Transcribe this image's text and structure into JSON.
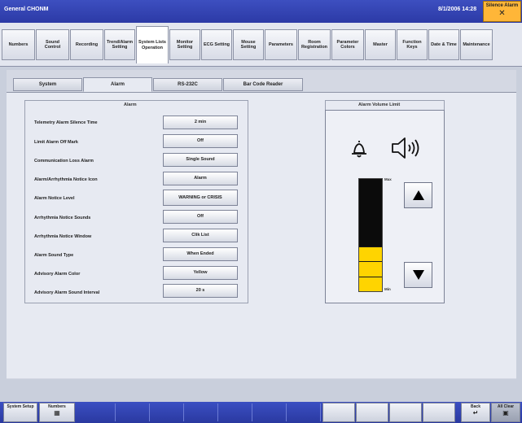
{
  "titlebar": {
    "app_title": "General CHONM",
    "datetime": "8/1/2006 14:28",
    "silence_label": "Silence Alarm"
  },
  "top_tabs": [
    {
      "label": "Numbers"
    },
    {
      "label": "Sound Control"
    },
    {
      "label": "Recording"
    },
    {
      "label": "Trend/Alarm Setting"
    },
    {
      "label": "System Lists Operation"
    },
    {
      "label": "Monitor Setting"
    },
    {
      "label": "ECG Setting"
    },
    {
      "label": "Mouse Setting"
    },
    {
      "label": "Parameters"
    },
    {
      "label": "Room Registration"
    },
    {
      "label": "Parameter Colors"
    },
    {
      "label": "Master"
    },
    {
      "label": "Function Keys"
    },
    {
      "label": "Date & Time"
    },
    {
      "label": "Maintenance"
    }
  ],
  "sub_tabs": [
    {
      "label": "System"
    },
    {
      "label": "Alarm"
    },
    {
      "label": "RS-232C"
    },
    {
      "label": "Bar Code Reader"
    }
  ],
  "alarm_group": {
    "title": "Alarm",
    "settings": [
      {
        "label": "Telemetry Alarm Silence Time",
        "value": "2 min"
      },
      {
        "label": "Limit Alarm Off Mark",
        "value": "Off"
      },
      {
        "label": "Communication Loss Alarm",
        "value": "Single Sound"
      },
      {
        "label": "Alarm/Arrhythmia Notice Icon",
        "value": "Alarm"
      },
      {
        "label": "Alarm Notice Level",
        "value": "WARNING or CRISIS"
      },
      {
        "label": "Arrhythmia Notice Sounds",
        "value": "Off"
      },
      {
        "label": "Arrhythmia Notice Window",
        "value": "Clik List"
      },
      {
        "label": "Alarm Sound Type",
        "value": "When Ended"
      },
      {
        "label": "Advisory Alarm Color",
        "value": "Yellow"
      },
      {
        "label": "Advisory Alarm Sound Interval",
        "value": "20 s"
      }
    ]
  },
  "volume": {
    "title": "Alarm Volume Limit",
    "max_label": "Max",
    "min_label": "Min",
    "level": 0.4,
    "fill_color": "#ffd400"
  },
  "bottom": {
    "system_setup": "System Setup",
    "numbers": "Numbers",
    "back": "Back",
    "all_clear": "All Clear"
  }
}
